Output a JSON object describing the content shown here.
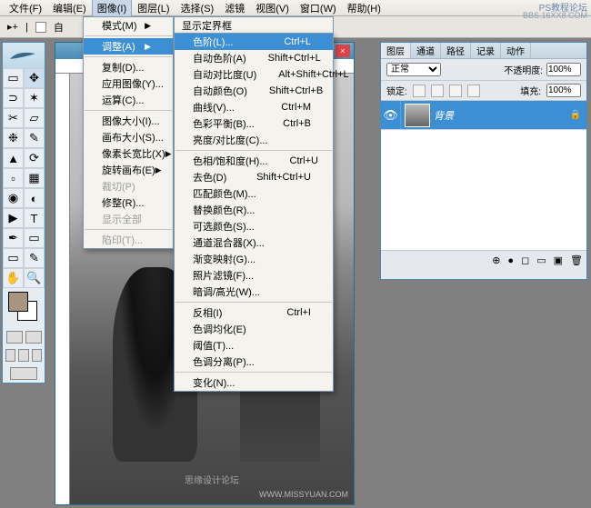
{
  "corner": {
    "line1": "PS教程论坛",
    "line2": "BBS.16XX8.COM"
  },
  "menubar": {
    "items": [
      "文件(F)",
      "编辑(E)",
      "图像(I)",
      "图层(L)",
      "选择(S)",
      "滤镜",
      "视图(V)",
      "窗口(W)",
      "帮助(H)"
    ],
    "activeIndex": 2
  },
  "toolbar": {
    "autoLabel": "自"
  },
  "menuImage": {
    "items": [
      {
        "label": "模式(M)",
        "arrow": true
      },
      {
        "sep": true
      },
      {
        "label": "调整(A)",
        "arrow": true,
        "hover": true
      },
      {
        "sep": true
      },
      {
        "label": "复制(D)...",
        "arrow": false
      },
      {
        "label": "应用图像(Y)...",
        "arrow": false
      },
      {
        "label": "运算(C)...",
        "arrow": false
      },
      {
        "sep": true
      },
      {
        "label": "图像大小(I)...",
        "arrow": false
      },
      {
        "label": "画布大小(S)...",
        "arrow": false
      },
      {
        "label": "像素长宽比(X)",
        "arrow": true
      },
      {
        "label": "旋转画布(E)",
        "arrow": true
      },
      {
        "label": "裁切(P)",
        "disabled": true
      },
      {
        "label": "修整(R)...",
        "arrow": false
      },
      {
        "label": "显示全部",
        "disabled": true
      },
      {
        "sep": true
      },
      {
        "label": "陷印(T)...",
        "disabled": true
      }
    ]
  },
  "menuAdjust": {
    "preTitle": "显示定界框",
    "items": [
      {
        "label": "色阶(L)...",
        "shortcut": "Ctrl+L",
        "hover": true
      },
      {
        "label": "自动色阶(A)",
        "shortcut": "Shift+Ctrl+L"
      },
      {
        "label": "自动对比度(U)",
        "shortcut": "Alt+Shift+Ctrl+L"
      },
      {
        "label": "自动颜色(O)",
        "shortcut": "Shift+Ctrl+B"
      },
      {
        "label": "曲线(V)...",
        "shortcut": "Ctrl+M"
      },
      {
        "label": "色彩平衡(B)...",
        "shortcut": "Ctrl+B"
      },
      {
        "label": "亮度/对比度(C)...",
        "shortcut": ""
      },
      {
        "sep": true
      },
      {
        "label": "色相/饱和度(H)...",
        "shortcut": "Ctrl+U"
      },
      {
        "label": "去色(D)",
        "shortcut": "Shift+Ctrl+U"
      },
      {
        "label": "匹配颜色(M)...",
        "shortcut": ""
      },
      {
        "label": "替换颜色(R)...",
        "shortcut": ""
      },
      {
        "label": "可选颜色(S)...",
        "shortcut": ""
      },
      {
        "label": "通道混合器(X)...",
        "shortcut": ""
      },
      {
        "label": "渐变映射(G)...",
        "shortcut": ""
      },
      {
        "label": "照片滤镜(F)...",
        "shortcut": ""
      },
      {
        "label": "暗调/高光(W)...",
        "shortcut": ""
      },
      {
        "sep": true
      },
      {
        "label": "反相(I)",
        "shortcut": "Ctrl+I"
      },
      {
        "label": "色调均化(E)",
        "shortcut": ""
      },
      {
        "label": "阈值(T)...",
        "shortcut": ""
      },
      {
        "label": "色调分离(P)...",
        "shortcut": ""
      },
      {
        "sep": true
      },
      {
        "label": "变化(N)...",
        "shortcut": ""
      }
    ]
  },
  "layers": {
    "tabs": [
      "图层",
      "通道",
      "路径",
      "记录",
      "动作"
    ],
    "activeTab": 0,
    "blendMode": "正常",
    "opacityLabel": "不透明度:",
    "opacityValue": "100%",
    "lockLabel": "锁定:",
    "fillLabel": "填充:",
    "fillValue": "100%",
    "layerItems": [
      {
        "name": "背景",
        "visible": true,
        "locked": true
      }
    ]
  },
  "watermarks": {
    "domain": "WWW.MISSYUAN.COM",
    "forum": "思缘设计论坛"
  }
}
